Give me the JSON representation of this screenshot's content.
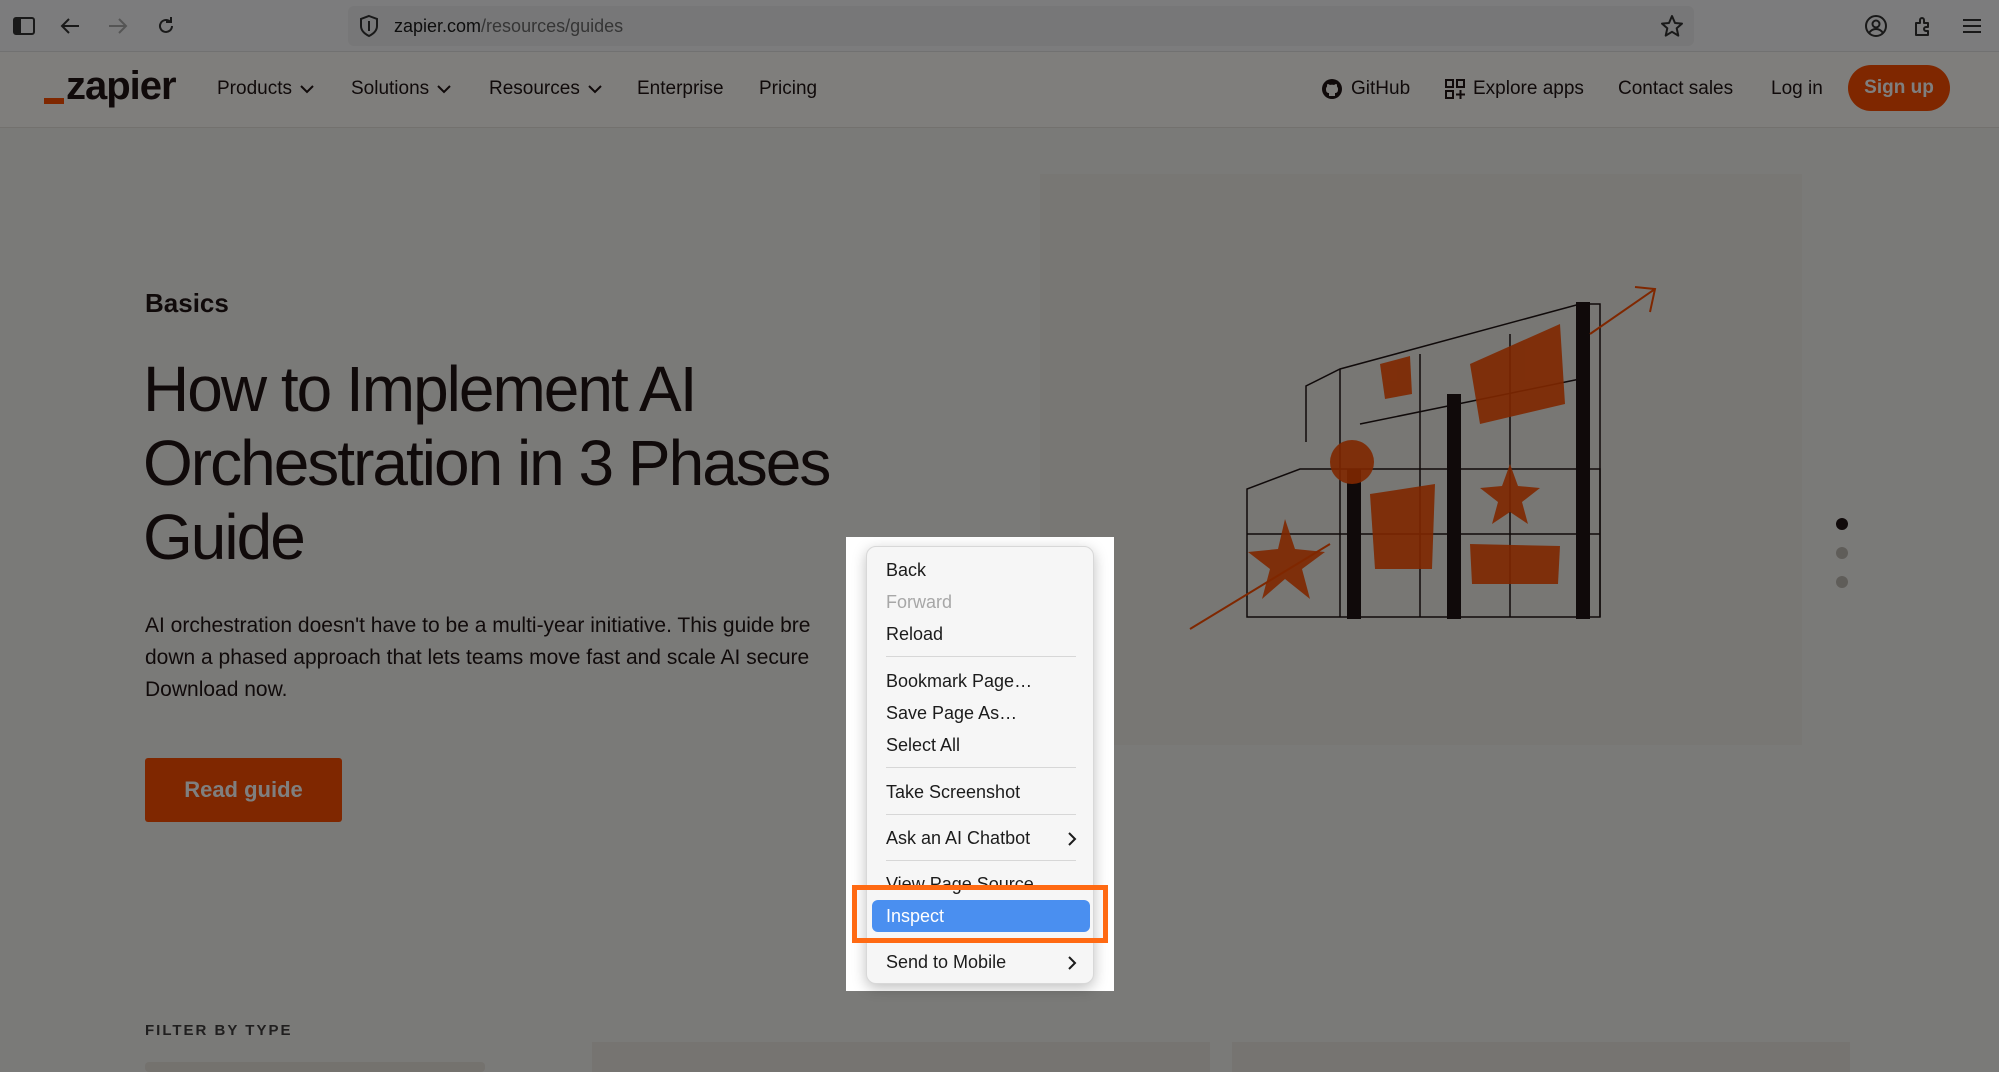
{
  "browser": {
    "url_host": "zapier.com",
    "url_path": "/resources/guides"
  },
  "site": {
    "logo_text": "zapier",
    "nav": {
      "products": "Products",
      "solutions": "Solutions",
      "resources": "Resources",
      "enterprise": "Enterprise",
      "pricing": "Pricing",
      "github": "GitHub",
      "explore_apps": "Explore apps",
      "contact_sales": "Contact sales",
      "login": "Log in",
      "signup": "Sign up"
    },
    "brand_color": "#ff4f00"
  },
  "hero": {
    "kicker": "Basics",
    "headline": "How to Implement AI Orchestration in 3 Phases Guide",
    "description": "AI orchestration doesn't have to be a multi-year initiative. This guide bre\ndown a phased approach that lets teams move fast and scale AI secure\nDownload now.",
    "cta": "Read guide",
    "carousel_total": 3,
    "carousel_active": 1
  },
  "filter": {
    "label": "FILTER BY TYPE"
  },
  "context_menu": {
    "items": [
      {
        "label": "Back",
        "enabled": true
      },
      {
        "label": "Forward",
        "enabled": false
      },
      {
        "label": "Reload",
        "enabled": true
      },
      {
        "label": "Bookmark Page…",
        "enabled": true
      },
      {
        "label": "Save Page As…",
        "enabled": true
      },
      {
        "label": "Select All",
        "enabled": true
      },
      {
        "label": "Take Screenshot",
        "enabled": true
      },
      {
        "label": "Ask an AI Chatbot",
        "enabled": true,
        "submenu": true
      },
      {
        "label": "View Page Source",
        "enabled": true
      },
      {
        "label": "Inspect",
        "enabled": true,
        "highlighted": true
      },
      {
        "label": "Send to Mobile",
        "enabled": true,
        "submenu": true
      }
    ],
    "highlight_color": "#4a8ff0",
    "annotation_color": "#ff6a13"
  }
}
